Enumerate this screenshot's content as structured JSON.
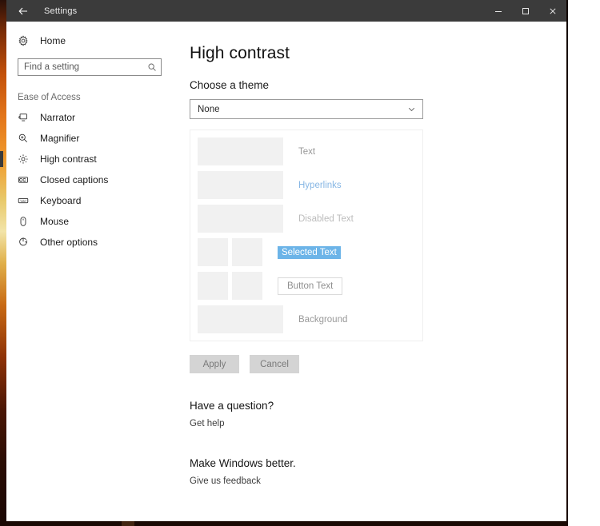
{
  "window": {
    "title": "Settings",
    "back_icon": "back-arrow-icon",
    "controls": {
      "minimize": "minimize-icon",
      "maximize": "maximize-icon",
      "close": "close-icon"
    }
  },
  "sidebar": {
    "home": {
      "label": "Home",
      "icon": "gear-icon"
    },
    "search": {
      "placeholder": "Find a setting",
      "value": "",
      "icon": "search-icon"
    },
    "group_title": "Ease of Access",
    "items": [
      {
        "label": "Narrator",
        "icon": "narrator-icon",
        "selected": false
      },
      {
        "label": "Magnifier",
        "icon": "magnifier-icon",
        "selected": false
      },
      {
        "label": "High contrast",
        "icon": "brightness-icon",
        "selected": true
      },
      {
        "label": "Closed captions",
        "icon": "closed-captions-icon",
        "selected": false
      },
      {
        "label": "Keyboard",
        "icon": "keyboard-icon",
        "selected": false
      },
      {
        "label": "Mouse",
        "icon": "mouse-icon",
        "selected": false
      },
      {
        "label": "Other options",
        "icon": "power-refresh-icon",
        "selected": false
      }
    ]
  },
  "main": {
    "page_title": "High contrast",
    "theme_label": "Choose a theme",
    "theme_select": {
      "value": "None",
      "chevron_icon": "chevron-down-icon"
    },
    "preview_rows": [
      {
        "label": "Text",
        "style": "text"
      },
      {
        "label": "Hyperlinks",
        "style": "link"
      },
      {
        "label": "Disabled Text",
        "style": "disabled"
      },
      {
        "label": "Selected Text",
        "style": "selected"
      },
      {
        "label": "Button Text",
        "style": "button"
      },
      {
        "label": "Background",
        "style": "text"
      }
    ],
    "buttons": {
      "apply": "Apply",
      "cancel": "Cancel"
    },
    "sections": [
      {
        "heading": "Have a question?",
        "link": "Get help"
      },
      {
        "heading": "Make Windows better.",
        "link": "Give us feedback"
      }
    ]
  },
  "colors": {
    "titlebar": "#3b3b3b",
    "accent_selection": "#6cb4e8",
    "hyperlink": "#86b6e4",
    "swatch": "#f1f1f1",
    "button_face": "#d4d4d4"
  }
}
